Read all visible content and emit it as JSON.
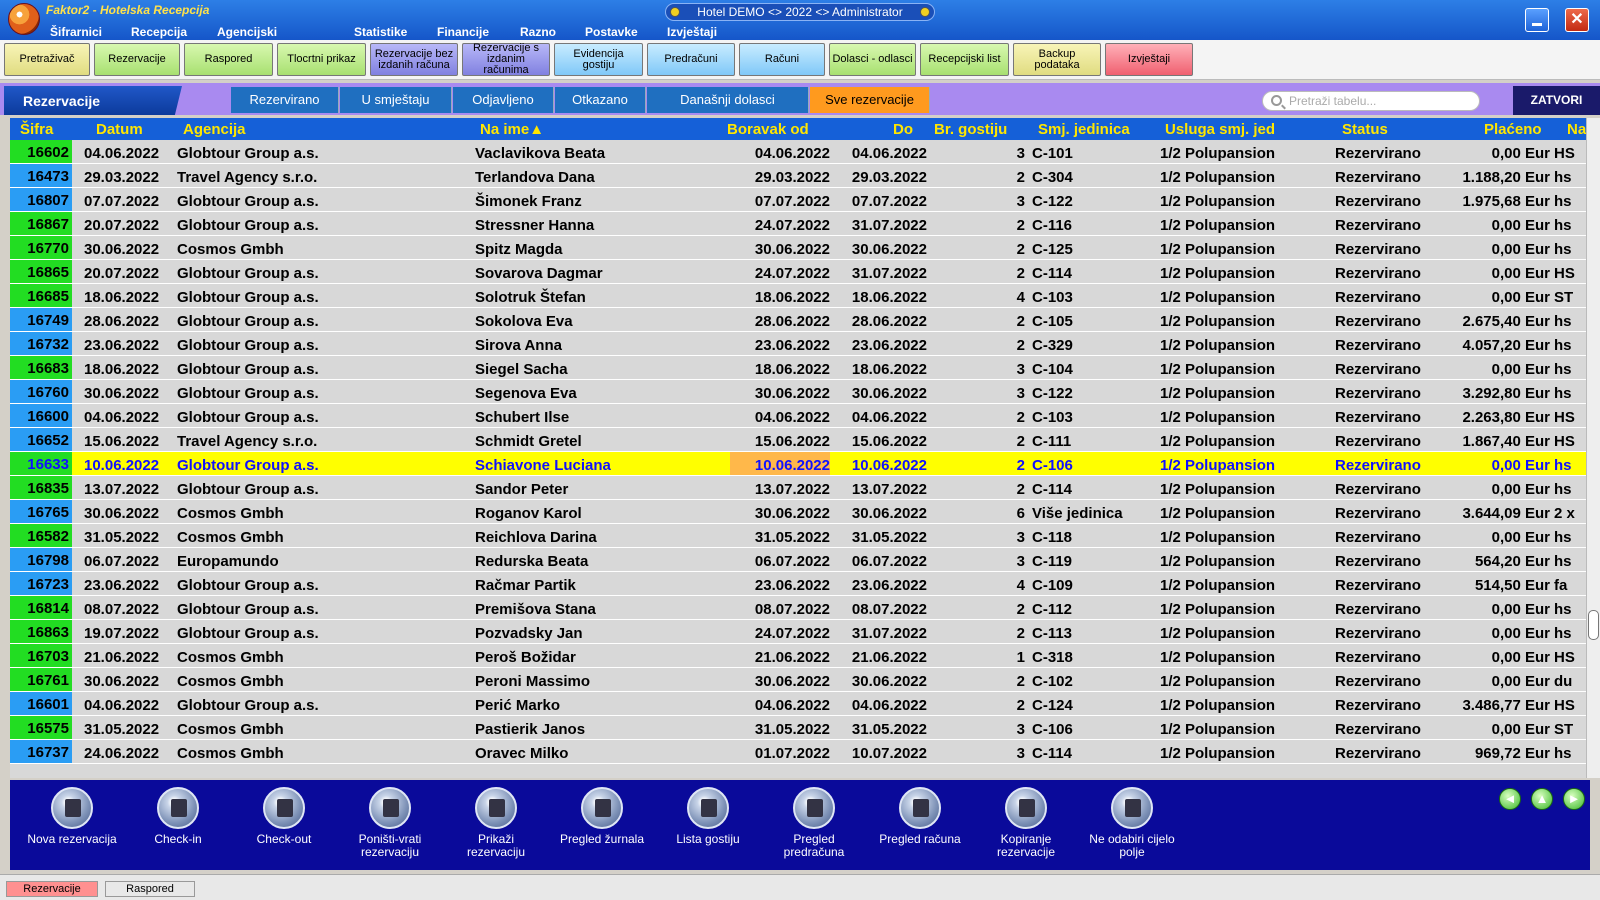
{
  "app": {
    "title": "Faktor2 - Hotelska Recepcija",
    "center_title": "Hotel DEMO <> 2022 <> Administrator",
    "close_symbol": "✕"
  },
  "menu": [
    "Šifrarnici",
    "Recepcija",
    "Agencijski poslovi",
    "Statistike",
    "Financije",
    "Razno",
    "Postavke",
    "Izvještaji"
  ],
  "toolbar": [
    {
      "label": "Pretraživač",
      "color": "yel"
    },
    {
      "label": "Rezervacije",
      "color": "grn"
    },
    {
      "label": "Raspored",
      "color": "grn"
    },
    {
      "label": "Tlocrtni prikaz",
      "color": "grn"
    },
    {
      "label": "Rezervacije bez izdanih računa",
      "color": "pur"
    },
    {
      "label": "Rezervacije s izdanim računima",
      "color": "pur"
    },
    {
      "label": "Evidencija gostiju",
      "color": "cyn"
    },
    {
      "label": "Predračuni",
      "color": "cyn"
    },
    {
      "label": "Računi",
      "color": "cyn"
    },
    {
      "label": "Dolasci - odlasci",
      "color": "grn"
    },
    {
      "label": "Recepcijski list",
      "color": "grn"
    },
    {
      "label": "Backup podataka",
      "color": "yel"
    },
    {
      "label": "Izvještaji",
      "color": "red"
    }
  ],
  "section_title": "Rezervacije",
  "filter_tabs": [
    {
      "label": "Rezervirano",
      "active": false
    },
    {
      "label": "U smještaju",
      "active": false
    },
    {
      "label": "Odjavljeno",
      "active": false
    },
    {
      "label": "Otkazano",
      "active": false
    },
    {
      "label": "Današnji dolasci",
      "active": false
    },
    {
      "label": "Sve rezervacije",
      "active": true
    }
  ],
  "search": {
    "placeholder": "Pretraži tabelu..."
  },
  "close_label": "ZATVORI",
  "columns": [
    "Šifra",
    "Datum",
    "Agencija",
    "Na ime▲",
    "Boravak od",
    "Do",
    "Br. gostiju",
    "Smj. jedinica",
    "Usluga smj. jed",
    "Status",
    "Plaćeno",
    "Na"
  ],
  "rows": [
    {
      "sifra": "16602",
      "marker": "green",
      "datum": "04.06.2022",
      "agencija": "Globtour Group a.s.",
      "ime": "Vaclavikova Beata",
      "od": "04.06.2022",
      "do": "04.06.2022",
      "gosti": "3",
      "jedinica": "C-101",
      "usluga": "1/2 Polupansion",
      "status": "Rezervirano",
      "placeno": "0,00 Eur",
      "na": "HS"
    },
    {
      "sifra": "16473",
      "marker": "blue",
      "datum": "29.03.2022",
      "agencija": "Travel Agency s.r.o.",
      "ime": "Terlandova Dana",
      "od": "29.03.2022",
      "do": "29.03.2022",
      "gosti": "2",
      "jedinica": "C-304",
      "usluga": "1/2 Polupansion",
      "status": "Rezervirano",
      "placeno": "1.188,20 Eur",
      "na": "hs"
    },
    {
      "sifra": "16807",
      "marker": "blue",
      "datum": "07.07.2022",
      "agencija": "Globtour Group a.s.",
      "ime": "Šimonek Franz",
      "od": "07.07.2022",
      "do": "07.07.2022",
      "gosti": "3",
      "jedinica": "C-122",
      "usluga": "1/2 Polupansion",
      "status": "Rezervirano",
      "placeno": "1.975,68 Eur",
      "na": "hs"
    },
    {
      "sifra": "16867",
      "marker": "green",
      "datum": "20.07.2022",
      "agencija": "Globtour Group a.s.",
      "ime": "Stressner Hanna",
      "od": "24.07.2022",
      "do": "31.07.2022",
      "gosti": "2",
      "jedinica": "C-116",
      "usluga": "1/2 Polupansion",
      "status": "Rezervirano",
      "placeno": "0,00 Eur",
      "na": "hs"
    },
    {
      "sifra": "16770",
      "marker": "green",
      "datum": "30.06.2022",
      "agencija": "Cosmos Gmbh",
      "ime": "Spitz Magda",
      "od": "30.06.2022",
      "do": "30.06.2022",
      "gosti": "2",
      "jedinica": "C-125",
      "usluga": "1/2 Polupansion",
      "status": "Rezervirano",
      "placeno": "0,00 Eur",
      "na": "hs"
    },
    {
      "sifra": "16865",
      "marker": "green",
      "datum": "20.07.2022",
      "agencija": "Globtour Group a.s.",
      "ime": "Sovarova Dagmar",
      "od": "24.07.2022",
      "do": "31.07.2022",
      "gosti": "2",
      "jedinica": "C-114",
      "usluga": "1/2 Polupansion",
      "status": "Rezervirano",
      "placeno": "0,00 Eur",
      "na": "HS"
    },
    {
      "sifra": "16685",
      "marker": "green",
      "datum": "18.06.2022",
      "agencija": "Globtour Group a.s.",
      "ime": "Solotruk Štefan",
      "od": "18.06.2022",
      "do": "18.06.2022",
      "gosti": "4",
      "jedinica": "C-103",
      "usluga": "1/2 Polupansion",
      "status": "Rezervirano",
      "placeno": "0,00 Eur",
      "na": "ST"
    },
    {
      "sifra": "16749",
      "marker": "blue",
      "datum": "28.06.2022",
      "agencija": "Globtour Group a.s.",
      "ime": "Sokolova Eva",
      "od": "28.06.2022",
      "do": "28.06.2022",
      "gosti": "2",
      "jedinica": "C-105",
      "usluga": "1/2 Polupansion",
      "status": "Rezervirano",
      "placeno": "2.675,40 Eur",
      "na": "hs"
    },
    {
      "sifra": "16732",
      "marker": "blue",
      "datum": "23.06.2022",
      "agencija": "Globtour Group a.s.",
      "ime": "Sirova Anna",
      "od": "23.06.2022",
      "do": "23.06.2022",
      "gosti": "2",
      "jedinica": "C-329",
      "usluga": "1/2 Polupansion",
      "status": "Rezervirano",
      "placeno": "4.057,20 Eur",
      "na": "hs"
    },
    {
      "sifra": "16683",
      "marker": "green",
      "datum": "18.06.2022",
      "agencija": "Globtour Group a.s.",
      "ime": "Siegel Sacha",
      "od": "18.06.2022",
      "do": "18.06.2022",
      "gosti": "3",
      "jedinica": "C-104",
      "usluga": "1/2 Polupansion",
      "status": "Rezervirano",
      "placeno": "0,00 Eur",
      "na": "hs"
    },
    {
      "sifra": "16760",
      "marker": "blue",
      "datum": "30.06.2022",
      "agencija": "Globtour Group a.s.",
      "ime": "Segenova Eva",
      "od": "30.06.2022",
      "do": "30.06.2022",
      "gosti": "3",
      "jedinica": "C-122",
      "usluga": "1/2 Polupansion",
      "status": "Rezervirano",
      "placeno": "3.292,80 Eur",
      "na": "hs"
    },
    {
      "sifra": "16600",
      "marker": "blue",
      "datum": "04.06.2022",
      "agencija": "Globtour Group a.s.",
      "ime": "Schubert Ilse",
      "od": "04.06.2022",
      "do": "04.06.2022",
      "gosti": "2",
      "jedinica": "C-103",
      "usluga": "1/2 Polupansion",
      "status": "Rezervirano",
      "placeno": "2.263,80 Eur",
      "na": "HS"
    },
    {
      "sifra": "16652",
      "marker": "blue",
      "datum": "15.06.2022",
      "agencija": "Travel Agency s.r.o.",
      "ime": "Schmidt Gretel",
      "od": "15.06.2022",
      "do": "15.06.2022",
      "gosti": "2",
      "jedinica": "C-111",
      "usluga": "1/2 Polupansion",
      "status": "Rezervirano",
      "placeno": "1.867,40 Eur",
      "na": "HS"
    },
    {
      "sifra": "16633",
      "marker": "green",
      "selected": true,
      "datum": "10.06.2022",
      "agencija": "Globtour Group a.s.",
      "ime": "Schiavone Luciana",
      "od": "10.06.2022",
      "do": "10.06.2022",
      "gosti": "2",
      "jedinica": "C-106",
      "usluga": "1/2 Polupansion",
      "status": "Rezervirano",
      "placeno": "0,00 Eur",
      "na": "hs"
    },
    {
      "sifra": "16835",
      "marker": "green",
      "datum": "13.07.2022",
      "agencija": "Globtour Group a.s.",
      "ime": "Sandor Peter",
      "od": "13.07.2022",
      "do": "13.07.2022",
      "gosti": "2",
      "jedinica": "C-114",
      "usluga": "1/2 Polupansion",
      "status": "Rezervirano",
      "placeno": "0,00 Eur",
      "na": "hs"
    },
    {
      "sifra": "16765",
      "marker": "blue",
      "datum": "30.06.2022",
      "agencija": "Cosmos Gmbh",
      "ime": "Roganov Karol",
      "od": "30.06.2022",
      "do": "30.06.2022",
      "gosti": "6",
      "jedinica": "Više jedinica",
      "usluga": "1/2 Polupansion",
      "status": "Rezervirano",
      "placeno": "3.644,09 Eur",
      "na": "2 x"
    },
    {
      "sifra": "16582",
      "marker": "green",
      "datum": "31.05.2022",
      "agencija": "Cosmos Gmbh",
      "ime": "Reichlova Darina",
      "od": "31.05.2022",
      "do": "31.05.2022",
      "gosti": "3",
      "jedinica": "C-118",
      "usluga": "1/2 Polupansion",
      "status": "Rezervirano",
      "placeno": "0,00 Eur",
      "na": "hs"
    },
    {
      "sifra": "16798",
      "marker": "blue",
      "datum": "06.07.2022",
      "agencija": "Europamundo",
      "ime": "Redurska Beata",
      "od": "06.07.2022",
      "do": "06.07.2022",
      "gosti": "3",
      "jedinica": "C-119",
      "usluga": "1/2 Polupansion",
      "status": "Rezervirano",
      "placeno": "564,20 Eur",
      "na": "hs"
    },
    {
      "sifra": "16723",
      "marker": "blue",
      "datum": "23.06.2022",
      "agencija": "Globtour Group a.s.",
      "ime": "Račmar Partik",
      "od": "23.06.2022",
      "do": "23.06.2022",
      "gosti": "4",
      "jedinica": "C-109",
      "usluga": "1/2 Polupansion",
      "status": "Rezervirano",
      "placeno": "514,50 Eur",
      "na": "fa"
    },
    {
      "sifra": "16814",
      "marker": "green",
      "datum": "08.07.2022",
      "agencija": "Globtour Group a.s.",
      "ime": "Premišova Stana",
      "od": "08.07.2022",
      "do": "08.07.2022",
      "gosti": "2",
      "jedinica": "C-112",
      "usluga": "1/2 Polupansion",
      "status": "Rezervirano",
      "placeno": "0,00 Eur",
      "na": "hs"
    },
    {
      "sifra": "16863",
      "marker": "green",
      "datum": "19.07.2022",
      "agencija": "Globtour Group a.s.",
      "ime": "Pozvadsky Jan",
      "od": "24.07.2022",
      "do": "31.07.2022",
      "gosti": "2",
      "jedinica": "C-113",
      "usluga": "1/2 Polupansion",
      "status": "Rezervirano",
      "placeno": "0,00 Eur",
      "na": "hs"
    },
    {
      "sifra": "16703",
      "marker": "green",
      "datum": "21.06.2022",
      "agencija": "Cosmos Gmbh",
      "ime": "Peroš Božidar",
      "od": "21.06.2022",
      "do": "21.06.2022",
      "gosti": "1",
      "jedinica": "C-318",
      "usluga": "1/2 Polupansion",
      "status": "Rezervirano",
      "placeno": "0,00 Eur",
      "na": "HS"
    },
    {
      "sifra": "16761",
      "marker": "green",
      "datum": "30.06.2022",
      "agencija": "Cosmos Gmbh",
      "ime": "Peroni Massimo",
      "od": "30.06.2022",
      "do": "30.06.2022",
      "gosti": "2",
      "jedinica": "C-102",
      "usluga": "1/2 Polupansion",
      "status": "Rezervirano",
      "placeno": "0,00 Eur",
      "na": "du"
    },
    {
      "sifra": "16601",
      "marker": "blue",
      "datum": "04.06.2022",
      "agencija": "Globtour Group a.s.",
      "ime": "Perić Marko",
      "od": "04.06.2022",
      "do": "04.06.2022",
      "gosti": "2",
      "jedinica": "C-124",
      "usluga": "1/2 Polupansion",
      "status": "Rezervirano",
      "placeno": "3.486,77 Eur",
      "na": "HS"
    },
    {
      "sifra": "16575",
      "marker": "green",
      "datum": "31.05.2022",
      "agencija": "Cosmos Gmbh",
      "ime": "Pastierik Janos",
      "od": "31.05.2022",
      "do": "31.05.2022",
      "gosti": "3",
      "jedinica": "C-106",
      "usluga": "1/2 Polupansion",
      "status": "Rezervirano",
      "placeno": "0,00 Eur",
      "na": "ST"
    },
    {
      "sifra": "16737",
      "marker": "blue",
      "datum": "24.06.2022",
      "agencija": "Cosmos Gmbh",
      "ime": "Oravec Milko",
      "od": "01.07.2022",
      "do": "10.07.2022",
      "gosti": "3",
      "jedinica": "C-114",
      "usluga": "1/2 Polupansion",
      "status": "Rezervirano",
      "placeno": "969,72 Eur",
      "na": "hs"
    }
  ],
  "actions": [
    {
      "label": "Nova rezervacija",
      "icon": "new-reservation-icon"
    },
    {
      "label": "Check-in",
      "icon": "checkin-icon"
    },
    {
      "label": "Check-out",
      "icon": "checkout-icon"
    },
    {
      "label": "Poništi-vrati rezervaciju",
      "icon": "undo-reservation-icon"
    },
    {
      "label": "Prikaži rezervaciju",
      "icon": "show-reservation-icon"
    },
    {
      "label": "Pregled žurnala",
      "icon": "journal-icon"
    },
    {
      "label": "Lista gostiju",
      "icon": "guest-list-icon"
    },
    {
      "label": "Pregled predračuna",
      "icon": "proforma-icon"
    },
    {
      "label": "Pregled računa",
      "icon": "invoice-icon"
    },
    {
      "label": "Kopiranje rezervacije",
      "icon": "copy-reservation-icon"
    },
    {
      "label": "Ne odabiri cijelo polje",
      "icon": "no-select-field-icon"
    }
  ],
  "nav_arrows": [
    "◄",
    "▲",
    "►"
  ],
  "status_tabs": [
    {
      "label": "Rezervacije",
      "active": true
    },
    {
      "label": "Raspored",
      "active": false
    }
  ],
  "colors": {
    "marker_green": "#22dd22",
    "marker_blue": "#2a9df4",
    "header_bg": "#1560d8",
    "header_text": "#ffe600",
    "selected_row": "#ffff00"
  }
}
